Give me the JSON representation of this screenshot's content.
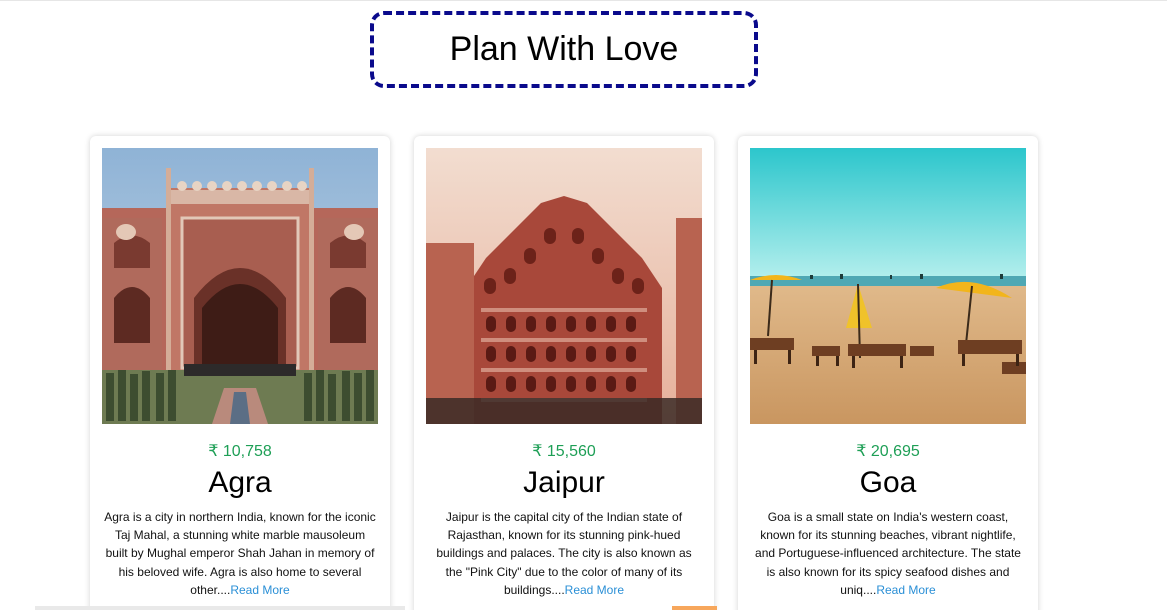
{
  "header": {
    "title": "Plan With Love"
  },
  "cards": [
    {
      "price": "₹ 10,758",
      "city": "Agra",
      "description": "Agra is a city in northern India, known for the iconic Taj Mahal, a stunning white marble mausoleum built by Mughal emperor Shah Jahan in memory of his beloved wife. Agra is also home to several other....",
      "read_more": "Read More",
      "image": "agra-monument-image"
    },
    {
      "price": "₹ 15,560",
      "city": "Jaipur",
      "description": "Jaipur is the capital city of the Indian state of Rajasthan, known for its stunning pink-hued buildings and palaces. The city is also known as the \"Pink City\" due to the color of many of its buildings....",
      "read_more": "Read More",
      "image": "jaipur-hawa-mahal-image"
    },
    {
      "price": "₹ 20,695",
      "city": "Goa",
      "description": "Goa is a small state on India's western coast, known for its stunning beaches, vibrant nightlife, and Portuguese-influenced architecture. The state is also known for its spicy seafood dishes and uniq....",
      "read_more": "Read More",
      "image": "goa-beach-image"
    }
  ],
  "colors": {
    "title_border": "#0a0a8c",
    "price": "#1e9f56",
    "link": "#2a8fd6"
  }
}
